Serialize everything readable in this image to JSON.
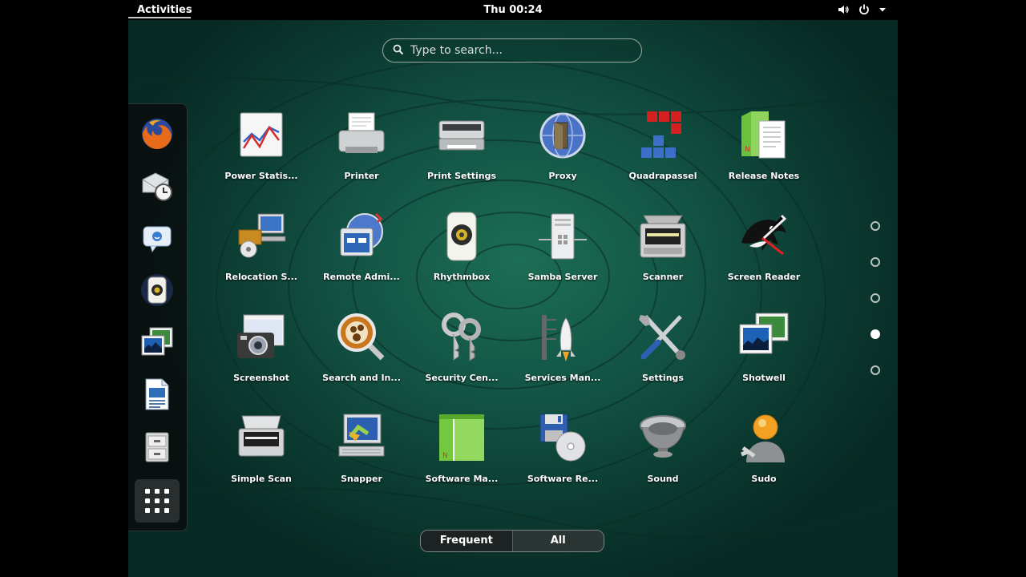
{
  "topbar": {
    "activities": "Activities",
    "clock": "Thu 00:24"
  },
  "search": {
    "placeholder": "Type to search..."
  },
  "dash": {
    "items": [
      "firefox",
      "evolution-mail",
      "empathy-chat",
      "rhythmbox",
      "shotwell",
      "libreoffice-writer",
      "file-cabinet",
      "show-applications"
    ]
  },
  "apps": [
    {
      "label": "Power Statis...",
      "icon": "power-statistics-icon"
    },
    {
      "label": "Printer",
      "icon": "printer-icon"
    },
    {
      "label": "Print Settings",
      "icon": "print-settings-icon"
    },
    {
      "label": "Proxy",
      "icon": "proxy-icon"
    },
    {
      "label": "Quadrapassel",
      "icon": "quadrapassel-icon"
    },
    {
      "label": "Release Notes",
      "icon": "release-notes-icon"
    },
    {
      "label": "Relocation S...",
      "icon": "relocation-server-icon"
    },
    {
      "label": "Remote Admi...",
      "icon": "remote-admin-icon"
    },
    {
      "label": "Rhythmbox",
      "icon": "rhythmbox-icon"
    },
    {
      "label": "Samba Server",
      "icon": "samba-server-icon"
    },
    {
      "label": "Scanner",
      "icon": "scanner-icon"
    },
    {
      "label": "Screen Reader",
      "icon": "screen-reader-icon"
    },
    {
      "label": "Screenshot",
      "icon": "screenshot-icon"
    },
    {
      "label": "Search and In...",
      "icon": "search-indexing-icon"
    },
    {
      "label": "Security Cen...",
      "icon": "security-center-icon"
    },
    {
      "label": "Services Man...",
      "icon": "services-manager-icon"
    },
    {
      "label": "Settings",
      "icon": "settings-icon"
    },
    {
      "label": "Shotwell",
      "icon": "shotwell-icon"
    },
    {
      "label": "Simple Scan",
      "icon": "simple-scan-icon"
    },
    {
      "label": "Snapper",
      "icon": "snapper-icon"
    },
    {
      "label": "Software Ma...",
      "icon": "software-manager-icon"
    },
    {
      "label": "Software Re...",
      "icon": "software-repositories-icon"
    },
    {
      "label": "Sound",
      "icon": "sound-icon"
    },
    {
      "label": "Sudo",
      "icon": "sudo-icon"
    }
  ],
  "pager": {
    "pages": 5,
    "active": 4
  },
  "tabs": {
    "frequent": "Frequent",
    "all": "All"
  }
}
